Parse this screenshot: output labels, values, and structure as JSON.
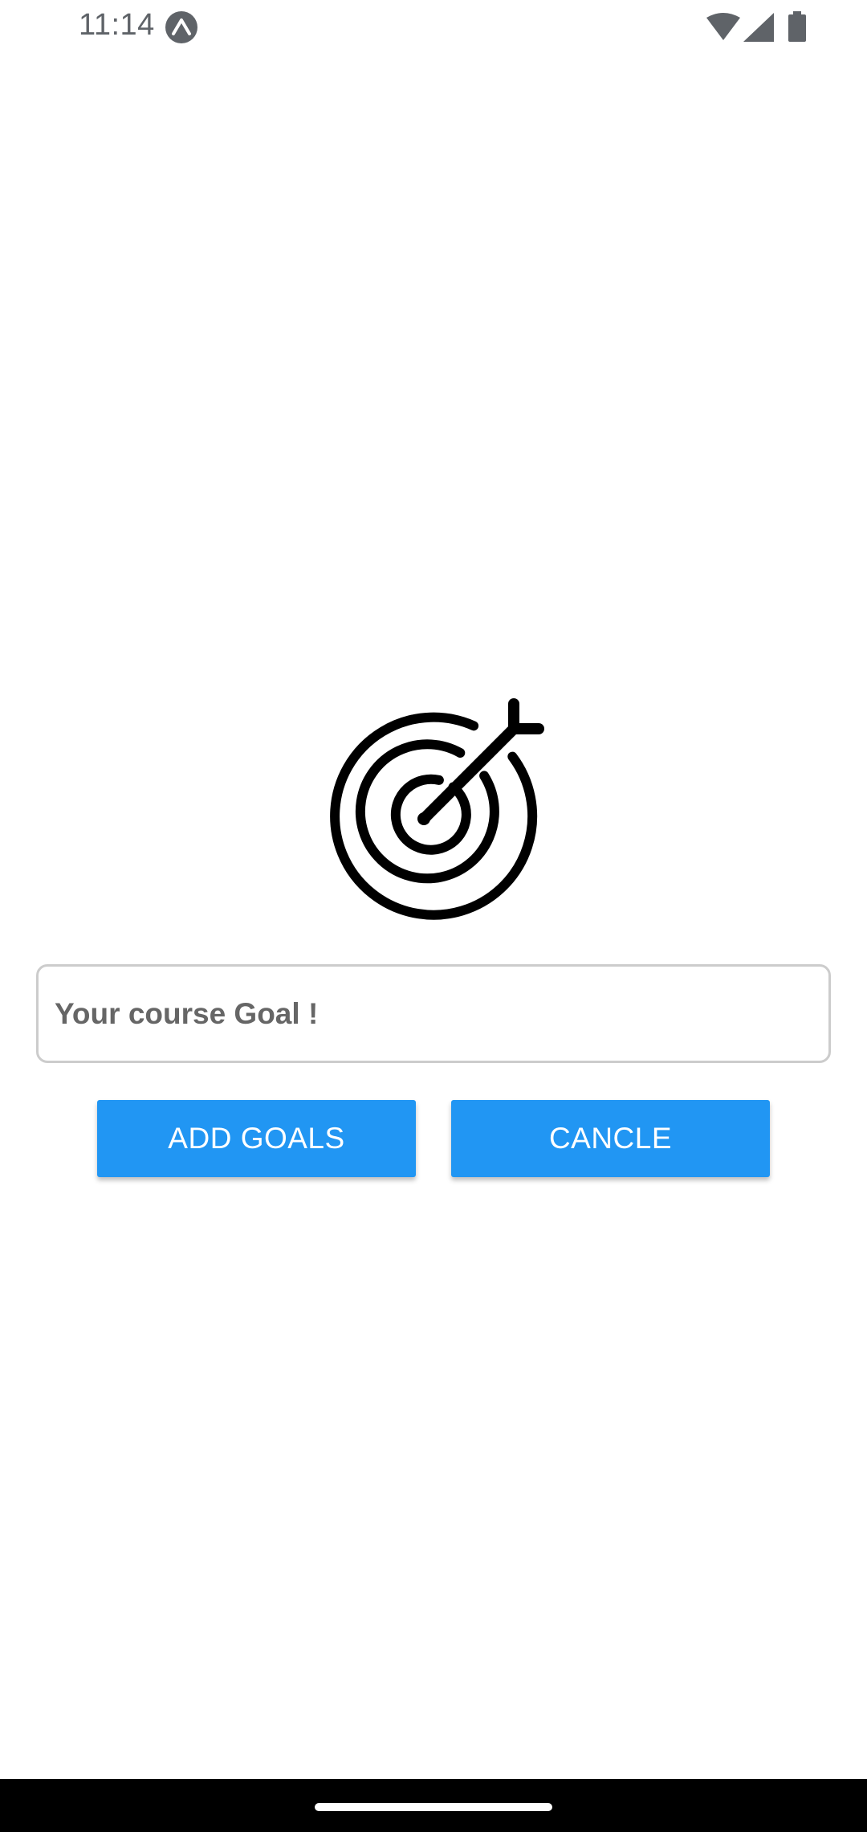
{
  "status_bar": {
    "time": "11:14",
    "icons": [
      "expo-icon",
      "wifi-icon",
      "signal-icon",
      "battery-icon"
    ]
  },
  "goal_image": {
    "icon": "target-icon"
  },
  "goal_input": {
    "value": "",
    "placeholder": "Your course Goal !"
  },
  "actions": {
    "add_label": "ADD GOALS",
    "cancel_label": "CANCLE"
  },
  "colors": {
    "button": "#2196f3",
    "button_text": "#ffffff",
    "input_border": "#cccccc",
    "placeholder": "#666666",
    "nav_bar": "#000000"
  }
}
